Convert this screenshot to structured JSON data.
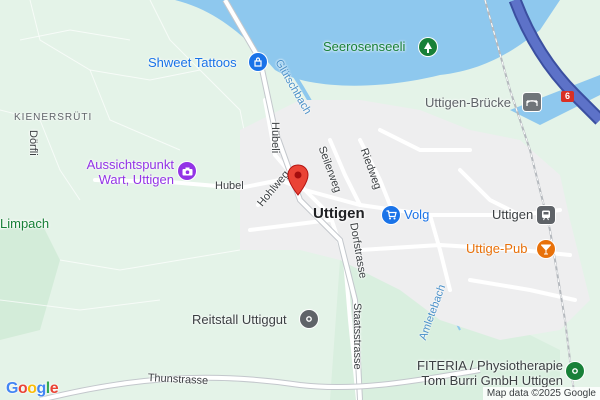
{
  "map": {
    "town_label": "Uttigen",
    "area_labels": {
      "kienersruti": "KIENERSRÜTI",
      "dorfli": "Dörfli",
      "limpach": "Limpach"
    },
    "streets": {
      "hubeli": "Hübeli",
      "hohlweg": "Hohlweg",
      "hubel": "Hubel",
      "seilerweg": "Seilerweg",
      "riedweg": "Riedweg",
      "dorfstrasse": "Dorfstrasse",
      "staatsstrasse": "Staatsstrasse",
      "thunstrasse": "Thunstrasse"
    },
    "waters": {
      "glutschbach": "Glütschbach",
      "amletebach": "Amletebach"
    },
    "highway_shield": "6",
    "pois": {
      "shweet_tattoos": {
        "name": "Shweet Tattoos",
        "icon": "shopping-bag-icon",
        "color": "#1a73e8"
      },
      "seerosenseeli": {
        "name": "Seerosenseeli",
        "icon": "tree-icon",
        "color": "#188038"
      },
      "uttigen_brucke": {
        "name": "Uttigen-Brücke",
        "icon": "bridge-icon",
        "color": "#70757a"
      },
      "aussichtspunkt": {
        "name_line1": "Aussichtspunkt",
        "name_line2": "Wart, Uttigen",
        "icon": "camera-icon",
        "color": "#9334e6"
      },
      "volg": {
        "name": "Volg",
        "icon": "shopping-cart-icon",
        "color": "#1a73e8"
      },
      "uttigen_station": {
        "name": "Uttigen",
        "icon": "train-icon",
        "color": "#5f6368"
      },
      "uttige_pub": {
        "name": "Uttige-Pub",
        "icon": "cocktail-icon",
        "color": "#e8710a"
      },
      "reitstall": {
        "name": "Reitstall Uttiggut",
        "icon": "place-icon",
        "color": "#5f6368"
      },
      "fiteria": {
        "name_line1": "FITERIA / Physiotherapie",
        "name_line2": "Tom Burri GmbH Uttigen",
        "icon": "place-icon",
        "color": "#188038"
      }
    },
    "marker": {
      "icon": "location-pin-icon",
      "color": "#ea4335"
    },
    "logo": {
      "letters": [
        "G",
        "o",
        "o",
        "g",
        "l",
        "e"
      ],
      "colors": [
        "#4285f4",
        "#ea4335",
        "#fbbc05",
        "#4285f4",
        "#34a853",
        "#ea4335"
      ]
    },
    "attribution": "Map data ©2025 Google"
  }
}
